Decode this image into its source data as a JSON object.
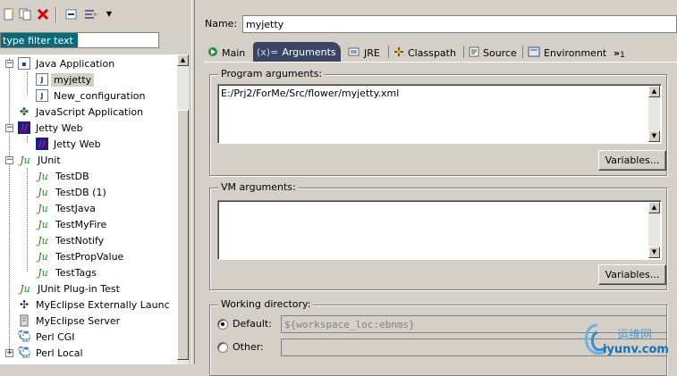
{
  "toolbar": {
    "icons": [
      "new-config-icon",
      "duplicate-icon",
      "delete-icon",
      "collapse-all-icon",
      "filter-icon",
      "view-menu-icon"
    ],
    "delete_color": "#d40000"
  },
  "filter": {
    "placeholder": "type filter text"
  },
  "tree": {
    "items": [
      {
        "label": "Java Application",
        "icon": "java-app-icon",
        "level": 1,
        "expanded": true
      },
      {
        "label": "myjetty",
        "icon": "java-config-icon",
        "level": 2,
        "selected": true
      },
      {
        "label": "New_configuration",
        "icon": "java-config-icon",
        "level": 2
      },
      {
        "label": "JavaScript Application",
        "icon": "javascript-icon",
        "level": 1
      },
      {
        "label": "Jetty Web",
        "icon": "jetty-icon",
        "level": 1,
        "expanded": true
      },
      {
        "label": "Jetty Web",
        "icon": "jetty-icon",
        "level": 2
      },
      {
        "label": "JUnit",
        "icon": "junit-icon",
        "level": 1,
        "expanded": true
      },
      {
        "label": "TestDB",
        "icon": "junit-icon",
        "level": 2
      },
      {
        "label": "TestDB (1)",
        "icon": "junit-icon",
        "level": 2
      },
      {
        "label": "TestJava",
        "icon": "junit-icon",
        "level": 2
      },
      {
        "label": "TestMyFire",
        "icon": "junit-icon",
        "level": 2
      },
      {
        "label": "TestNotify",
        "icon": "junit-icon",
        "level": 2
      },
      {
        "label": "TestPropValue",
        "icon": "junit-icon",
        "level": 2
      },
      {
        "label": "TestTags",
        "icon": "junit-icon",
        "level": 2
      },
      {
        "label": "JUnit Plug-in Test",
        "icon": "junit-plugin-icon",
        "level": 1
      },
      {
        "label": "MyEclipse Externally Launc",
        "icon": "myeclipse-icon",
        "level": 1
      },
      {
        "label": "MyEclipse Server",
        "icon": "server-icon",
        "level": 1
      },
      {
        "label": "Perl CGI",
        "icon": "camel-icon",
        "level": 1
      },
      {
        "label": "Perl Local",
        "icon": "camel-icon",
        "level": 1,
        "collapsed": true
      }
    ]
  },
  "config": {
    "name_label": "Name:",
    "name_value": "myjetty",
    "tabs": [
      {
        "label": "Main",
        "icon": "main-tab-icon"
      },
      {
        "label": "Arguments",
        "icon": "arguments-tab-icon",
        "active": true
      },
      {
        "label": "JRE",
        "icon": "jre-tab-icon"
      },
      {
        "label": "Classpath",
        "icon": "classpath-tab-icon"
      },
      {
        "label": "Source",
        "icon": "source-tab-icon"
      },
      {
        "label": "Environment",
        "icon": "environment-tab-icon"
      }
    ],
    "more_tabs": "»",
    "more_tabs_count": "1",
    "program_args_label": "Program arguments:",
    "program_args_value": "E:/Prj2/ForMe/Src/flower/myjetty.xml",
    "variables_button": "Variables...",
    "vm_args_label": "VM arguments:",
    "vm_args_value": "",
    "working_dir_label": "Working directory:",
    "default_label": "Default:",
    "default_value": "${workspace_loc:ebnms}",
    "other_label": "Other:",
    "other_value": ""
  },
  "watermark": {
    "cn": "运维网",
    "url": "iyunv.com"
  },
  "colors": {
    "active_tab_bg": "#3c4664",
    "filter_bg": "#0a6a7a",
    "dialog_bg": "#d4d0c8"
  }
}
